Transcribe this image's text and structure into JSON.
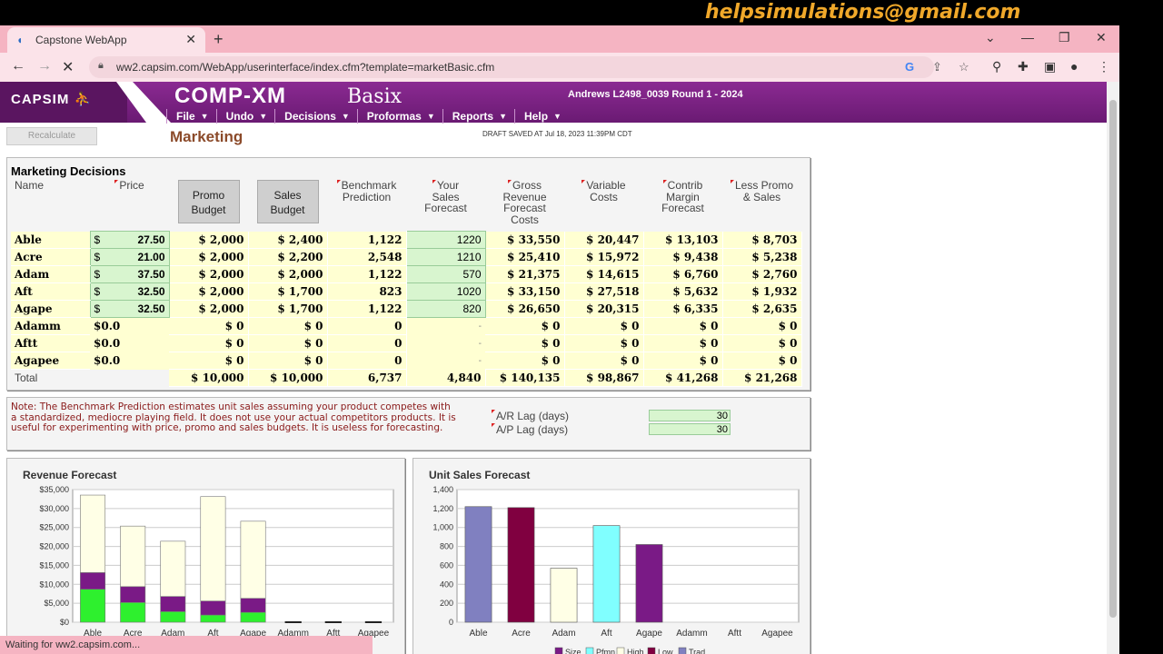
{
  "watermark": "helpsimulations@gmail.com",
  "browser": {
    "tab_title": "Capstone WebApp",
    "url": "ww2.capsim.com/WebApp/userinterface/index.cfm?template=marketBasic.cfm",
    "status": "Waiting for ww2.capsim.com..."
  },
  "app": {
    "logo": "CAPSIM",
    "product": "COMP-XM",
    "edition": "Basix",
    "round_info": "Andrews L2498_0039 Round 1 - 2024",
    "menu": [
      "File",
      "Undo",
      "Decisions",
      "Proformas",
      "Reports",
      "Help"
    ],
    "recalc": "Recalculate",
    "page_title": "Marketing",
    "draft": "DRAFT SAVED AT Jul 18, 2023 11:39PM CDT"
  },
  "marketing": {
    "title": "Marketing Decisions",
    "headers": {
      "name": "Name",
      "price": "Price",
      "promo": [
        "Promo",
        "Budget"
      ],
      "sales": [
        "Sales",
        "Budget"
      ],
      "benchmark": [
        "Benchmark",
        "Prediction"
      ],
      "forecast": [
        "Your",
        "Sales",
        "Forecast"
      ],
      "gross": [
        "Gross",
        "Revenue",
        "Forecast",
        "Costs"
      ],
      "variable": [
        "Variable",
        "Costs"
      ],
      "contrib": [
        "Contrib",
        "Margin",
        "Forecast"
      ],
      "less": [
        "Less Promo",
        "& Sales"
      ]
    },
    "rows": [
      {
        "name": "Able",
        "price": "27.50",
        "promo": "$ 2,000",
        "sales": "$ 2,400",
        "bench": "1,122",
        "forecast": "1220",
        "gross": "$ 33,550",
        "var": "$ 20,447",
        "contrib": "$ 13,103",
        "less": "$ 8,703"
      },
      {
        "name": "Acre",
        "price": "21.00",
        "promo": "$ 2,000",
        "sales": "$ 2,200",
        "bench": "2,548",
        "forecast": "1210",
        "gross": "$ 25,410",
        "var": "$ 15,972",
        "contrib": "$ 9,438",
        "less": "$ 5,238"
      },
      {
        "name": "Adam",
        "price": "37.50",
        "promo": "$ 2,000",
        "sales": "$ 2,000",
        "bench": "1,122",
        "forecast": "570",
        "gross": "$ 21,375",
        "var": "$ 14,615",
        "contrib": "$ 6,760",
        "less": "$ 2,760"
      },
      {
        "name": "Aft",
        "price": "32.50",
        "promo": "$ 2,000",
        "sales": "$ 1,700",
        "bench": "823",
        "forecast": "1020",
        "gross": "$ 33,150",
        "var": "$ 27,518",
        "contrib": "$ 5,632",
        "less": "$ 1,932"
      },
      {
        "name": "Agape",
        "price": "32.50",
        "promo": "$ 2,000",
        "sales": "$ 1,700",
        "bench": "1,122",
        "forecast": "820",
        "gross": "$ 26,650",
        "var": "$ 20,315",
        "contrib": "$ 6,335",
        "less": "$ 2,635"
      }
    ],
    "zero_rows": [
      {
        "name": "Adamm",
        "price": "$0.0"
      },
      {
        "name": "Aftt",
        "price": "$0.0"
      },
      {
        "name": "Agapee",
        "price": "$0.0"
      }
    ],
    "zero_values": {
      "money": "$ 0",
      "count": "0",
      "dash": "-"
    },
    "dollar": "$",
    "totals": {
      "label": "Total",
      "promo": "$ 10,000",
      "sales": "$ 10,000",
      "bench": "6,737",
      "forecast": "4,840",
      "gross": "$ 140,135",
      "var": "$ 98,867",
      "contrib": "$ 41,268",
      "less": "$ 21,268"
    }
  },
  "note": {
    "text": "Note: The Benchmark Prediction estimates unit sales assuming your product competes with a standardized, mediocre playing field. It does not use your actual competitors products. It is useful for experimenting with price, promo and sales budgets. It is useless for forecasting.",
    "ar_label": "A/R Lag (days)",
    "ar_value": "30",
    "ap_label": "A/P Lag (days)",
    "ap_value": "30"
  },
  "colors": {
    "purple": "#7a1a86",
    "green": "#2ef02e",
    "cream": "#ffffe6",
    "blue": "#8080c0",
    "maroon": "#800040",
    "cyan": "#80ffff",
    "header": "#7a1f84"
  },
  "chart_data": [
    {
      "type": "bar",
      "title": "Revenue Forecast",
      "categories": [
        "Able",
        "Acre",
        "Adam",
        "Aft",
        "Agape",
        "Adamm",
        "Aftt",
        "Agapee"
      ],
      "ylim": [
        0,
        35000
      ],
      "yticks": [
        "$0",
        "$5,000",
        "$10,000",
        "$15,000",
        "$20,000",
        "$25,000",
        "$30,000",
        "$35,000"
      ],
      "series": [
        {
          "color": "#2ef02e",
          "values": [
            8700,
            5200,
            2800,
            1900,
            2600,
            0,
            0,
            0
          ]
        },
        {
          "color": "#7a1a86",
          "values": [
            4400,
            4200,
            4000,
            3700,
            3700,
            0,
            0,
            0
          ]
        },
        {
          "color": "#ffffe6",
          "values": [
            20450,
            15970,
            14575,
            27550,
            20350,
            0,
            0,
            0
          ]
        }
      ]
    },
    {
      "type": "bar",
      "title": "Unit Sales Forecast",
      "categories": [
        "Able",
        "Acre",
        "Adam",
        "Aft",
        "Agape",
        "Adamm",
        "Aftt",
        "Agapee"
      ],
      "ylim": [
        0,
        1400
      ],
      "yticks": [
        "0",
        "200",
        "400",
        "600",
        "800",
        "1,000",
        "1,200",
        "1,400"
      ],
      "values": [
        1220,
        1210,
        570,
        1020,
        820,
        0,
        0,
        0
      ],
      "colors": [
        "#8080c0",
        "#800040",
        "#ffffe6",
        "#80ffff",
        "#7a1a86",
        "#8080c0",
        "#8080c0",
        "#8080c0"
      ],
      "legend": [
        {
          "label": "Size",
          "color": "#7a1a86"
        },
        {
          "label": "Pfmn",
          "color": "#80ffff"
        },
        {
          "label": "High",
          "color": "#ffffe6"
        },
        {
          "label": "Low",
          "color": "#800040"
        },
        {
          "label": "Trad",
          "color": "#8080c0"
        }
      ]
    }
  ]
}
